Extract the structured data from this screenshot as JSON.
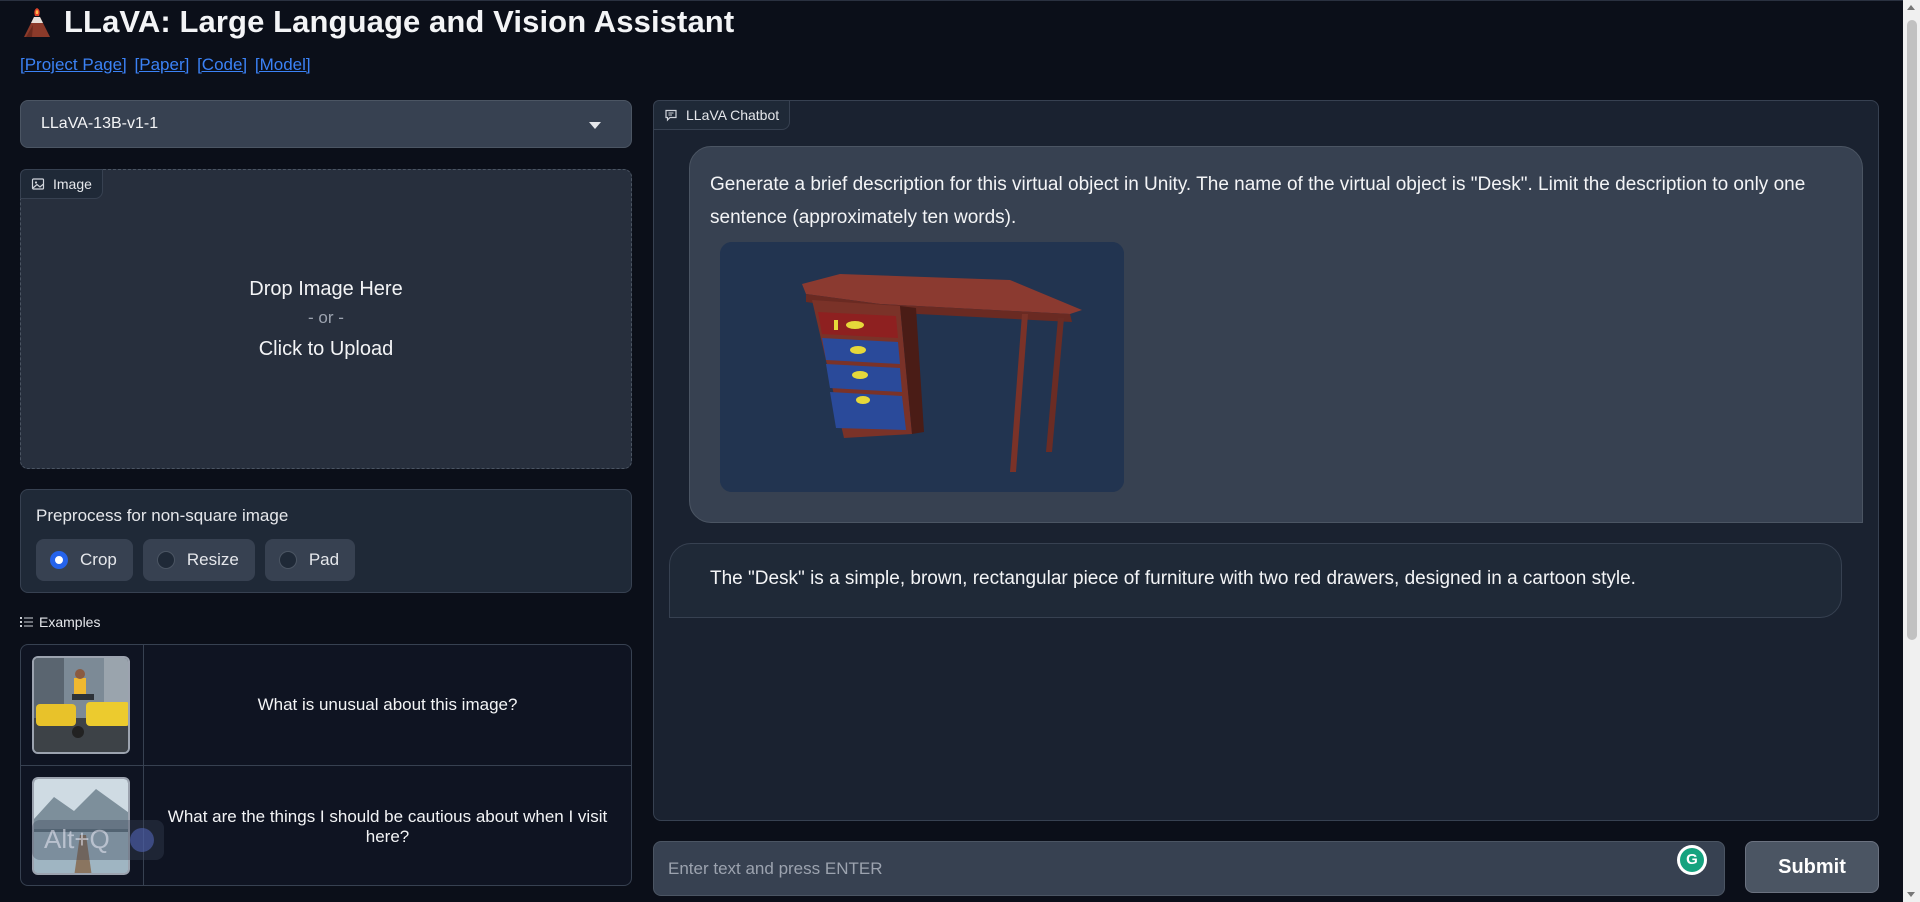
{
  "header": {
    "title": "LLaVA: Large Language and Vision Assistant",
    "links": [
      "[Project Page]",
      "[Paper]",
      "[Code]",
      "[Model]"
    ]
  },
  "model_select": {
    "value": "LLaVA-13B-v1-1"
  },
  "image_upload": {
    "label": "Image",
    "drop_text": "Drop Image Here",
    "or_text": "- or -",
    "click_text": "Click to Upload"
  },
  "preprocess": {
    "label": "Preprocess for non-square image",
    "options": [
      "Crop",
      "Resize",
      "Pad"
    ],
    "selected": "Crop"
  },
  "examples": {
    "label": "Examples",
    "items": [
      {
        "text": "What is unusual about this image?"
      },
      {
        "text": "What are the things I should be cautious about when I visit here?"
      }
    ]
  },
  "chatbot": {
    "label": "LLaVA Chatbot",
    "user_message": "Generate a brief description for this virtual object in Unity. The name of the virtual object is \"Desk\". Limit the description to only one sentence (approximately ten words).",
    "bot_message": "The \"Desk\" is a simple, brown, rectangular piece of furniture with two red drawers, designed in a cartoon style."
  },
  "input": {
    "placeholder": "Enter text and press ENTER",
    "submit_label": "Submit"
  },
  "overlay": {
    "shortcut": "Alt+Q"
  },
  "colors": {
    "background": "#0b0f19",
    "panel": "#1f2937",
    "accent": "#2563eb",
    "link": "#3b82f6"
  }
}
